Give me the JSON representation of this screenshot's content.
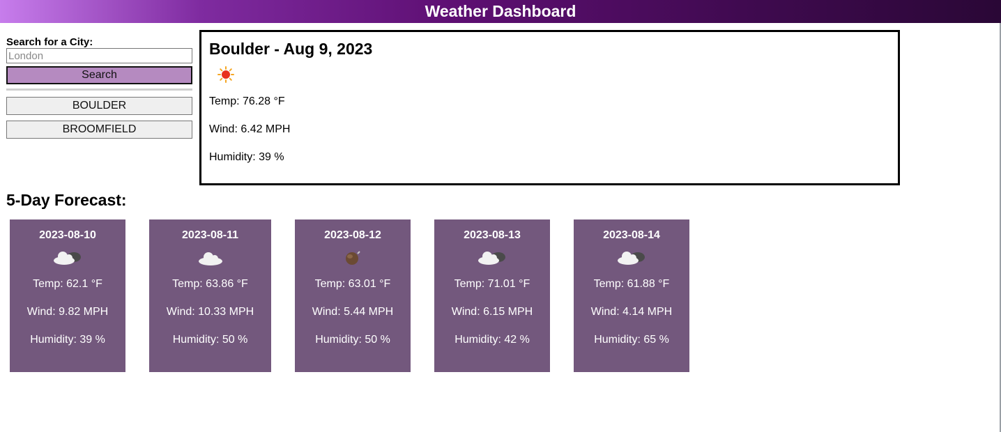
{
  "header": {
    "title": "Weather Dashboard"
  },
  "search": {
    "label": "Search for a City:",
    "placeholder": "London",
    "button_label": "Search"
  },
  "history": [
    {
      "label": "BOULDER"
    },
    {
      "label": "BROOMFIELD"
    }
  ],
  "current": {
    "title": "Boulder - Aug 9, 2023",
    "icon": "sun-icon",
    "temp": "Temp: 76.28 °F",
    "wind": "Wind: 6.42 MPH",
    "humidity": "Humidity: 39 %"
  },
  "forecast": {
    "title": "5-Day Forecast:",
    "days": [
      {
        "date": "2023-08-10",
        "icon": "clouds-icon",
        "temp": "Temp: 62.1 °F",
        "wind": "Wind: 9.82 MPH",
        "humidity": "Humidity: 39 %"
      },
      {
        "date": "2023-08-11",
        "icon": "cloud-icon",
        "temp": "Temp: 63.86 °F",
        "wind": "Wind: 10.33 MPH",
        "humidity": "Humidity: 50 %"
      },
      {
        "date": "2023-08-12",
        "icon": "rain-icon",
        "temp": "Temp: 63.01 °F",
        "wind": "Wind: 5.44 MPH",
        "humidity": "Humidity: 50 %"
      },
      {
        "date": "2023-08-13",
        "icon": "clouds-icon",
        "temp": "Temp: 71.01 °F",
        "wind": "Wind: 6.15 MPH",
        "humidity": "Humidity: 42 %"
      },
      {
        "date": "2023-08-14",
        "icon": "clouds-icon",
        "temp": "Temp: 61.88 °F",
        "wind": "Wind: 4.14 MPH",
        "humidity": "Humidity: 65 %"
      }
    ]
  },
  "colors": {
    "card_bg": "#73587d",
    "search_button_bg": "#b58ac0",
    "header_gradient_start": "#c77dec",
    "header_gradient_end": "#2a0736"
  }
}
